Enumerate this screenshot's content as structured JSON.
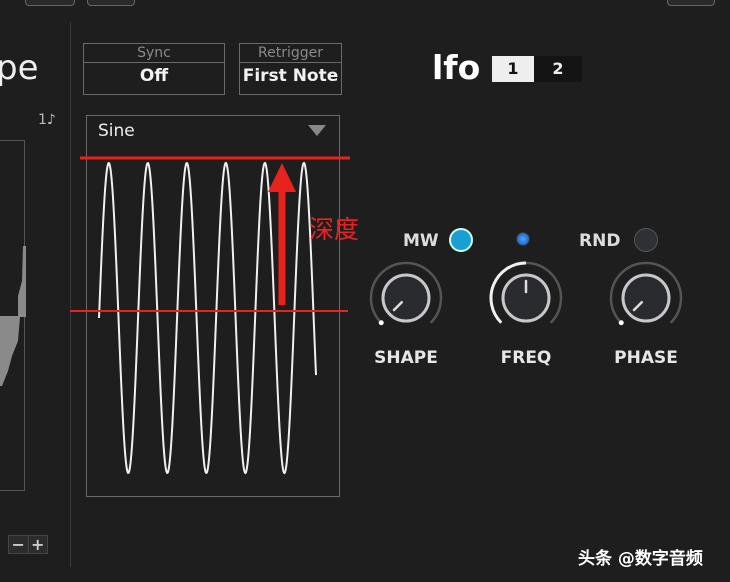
{
  "left_panel": {
    "title_fragment": "pe",
    "rate_label": "1♪",
    "zoom_minus": "−",
    "zoom_plus": "+"
  },
  "sync": {
    "label": "Sync",
    "value": "Off"
  },
  "retrigger": {
    "label": "Retrigger",
    "value": "First Note"
  },
  "waveform": {
    "selected": "Sine",
    "cycles": 5.56
  },
  "annotation": {
    "text": "深度",
    "color": "#e8231f"
  },
  "lfo": {
    "title": "lfo",
    "tabs": [
      "1",
      "2"
    ],
    "active_tab": "1"
  },
  "modes": {
    "mw_label": "MW",
    "rnd_label": "RND",
    "mw_on": true,
    "rnd_on": false,
    "accent": "#1a9fd4"
  },
  "knobs": [
    {
      "label": "SHAPE",
      "value": 0.0
    },
    {
      "label": "FREQ",
      "value": 0.5
    },
    {
      "label": "PHASE",
      "value": 0.0
    }
  ],
  "watermark": "头条 @数字音频"
}
